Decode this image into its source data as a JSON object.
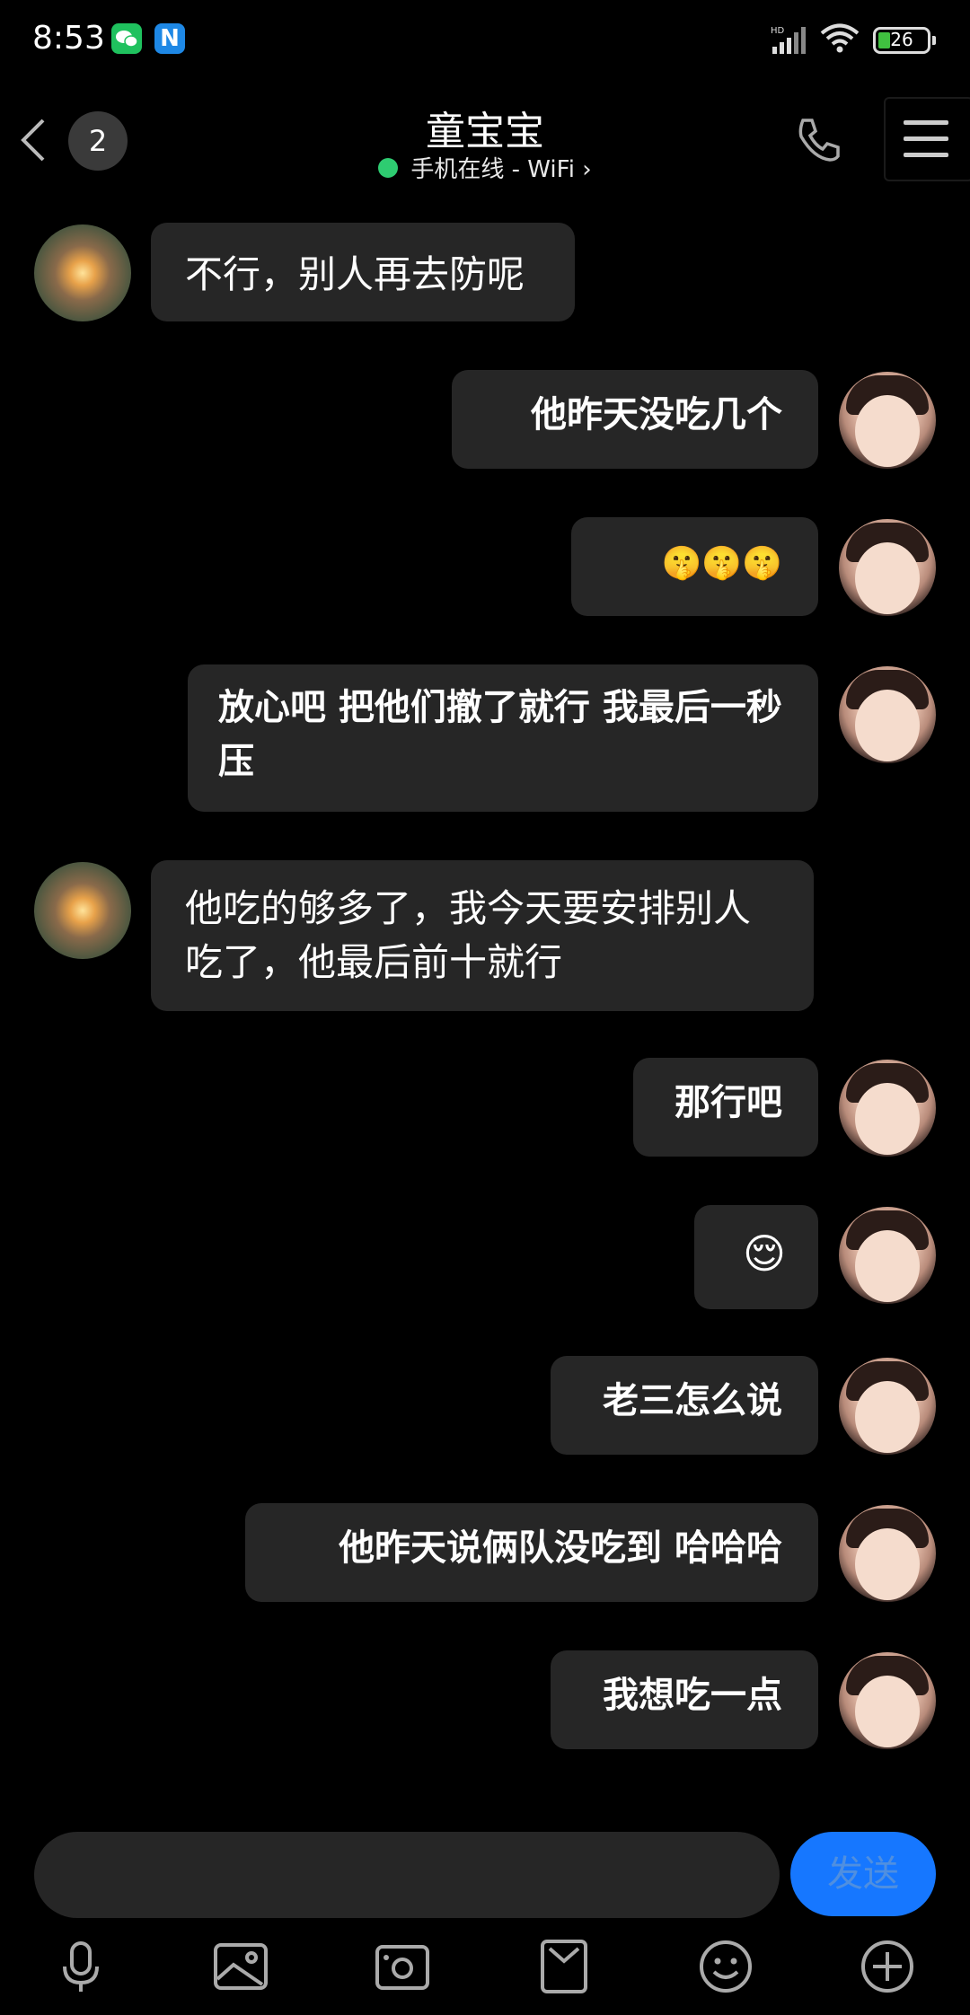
{
  "status_bar": {
    "time": "8:53",
    "battery": "26"
  },
  "header": {
    "back_label": "",
    "unread_count": "2",
    "contact_name": "童宝宝",
    "status_text": "手机在线 - WiFi"
  },
  "messages": [
    {
      "side": "left",
      "text": "不行，别人再去防呢"
    },
    {
      "side": "right",
      "text": "他昨天没吃几个"
    },
    {
      "side": "right",
      "text": "🤫🤫🤫"
    },
    {
      "side": "right",
      "text": "放心吧 把他们撤了就行 我最后一秒压"
    },
    {
      "side": "left",
      "text": "他吃的够多了，我今天要安排别人吃了，他最后前十就行"
    },
    {
      "side": "right",
      "text": "那行吧"
    },
    {
      "side": "right",
      "text": "😌"
    },
    {
      "side": "right",
      "text": "老三怎么说"
    },
    {
      "side": "right",
      "text": "他昨天说俩队没吃到 哈哈哈"
    },
    {
      "side": "right",
      "text": "我想吃一点"
    }
  ],
  "composer": {
    "input_value": "",
    "send_label": "发送"
  },
  "toolbar": {
    "icons": [
      "microphone-icon",
      "image-icon",
      "camera-icon",
      "folder-icon",
      "emoji-icon",
      "plus-icon"
    ]
  },
  "colors": {
    "background": "#000000",
    "bubble": "#262626",
    "send": "#1677ff",
    "online": "#2ecc71"
  }
}
